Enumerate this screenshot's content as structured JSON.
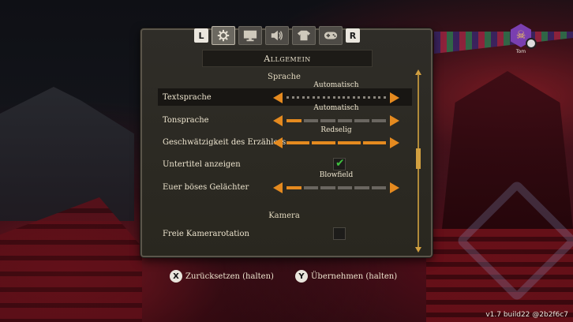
{
  "tabs": {
    "left_key": "L",
    "right_key": "R",
    "items": [
      {
        "icon": "gear-icon",
        "active": true
      },
      {
        "icon": "monitor-icon",
        "active": false
      },
      {
        "icon": "speaker-icon",
        "active": false
      },
      {
        "icon": "shirt-icon",
        "active": false
      },
      {
        "icon": "gamepad-icon",
        "active": false
      }
    ]
  },
  "panel": {
    "title": "Allgemein"
  },
  "sections": {
    "language_title": "Sprache",
    "camera_title": "Kamera"
  },
  "settings": {
    "text_language": {
      "label": "Textsprache",
      "value": "Automatisch",
      "level": 0,
      "segments": 10
    },
    "voice_language": {
      "label": "Tonsprache",
      "value": "Automatisch",
      "level": 1,
      "segments": 6
    },
    "narrator": {
      "label": "Geschwätzigkeit des Erzählers",
      "value": "Redselig",
      "level": 4,
      "segments": 4
    },
    "subtitles": {
      "label": "Untertitel anzeigen",
      "checked": true
    },
    "evil_laugh": {
      "label": "Euer böses Gelächter",
      "value": "Blowfield",
      "level": 1,
      "segments": 6
    },
    "free_camera": {
      "label": "Freie Kamerarotation",
      "checked": false
    }
  },
  "footer": {
    "reset_glyph": "X",
    "reset_label": "Zurücksetzen (halten)",
    "apply_glyph": "Y",
    "apply_label": "Übernehmen (halten)",
    "version": "v1.7 build22 @2b2f6c7"
  },
  "player": {
    "name": "Tom"
  },
  "colors": {
    "accent": "#e58a1f",
    "check": "#3fbf3f"
  }
}
